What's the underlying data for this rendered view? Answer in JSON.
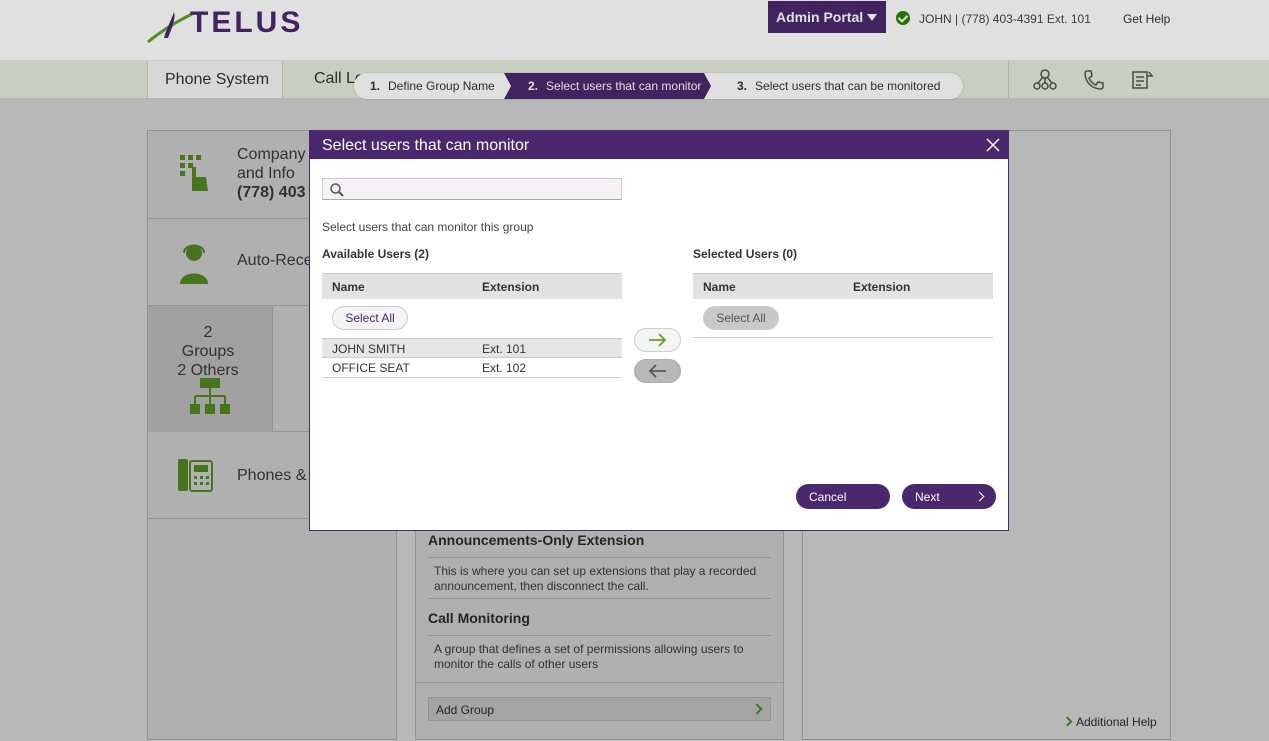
{
  "header": {
    "logo_text": "TELUS",
    "admin_portal_label": "Admin Portal",
    "user_info": "JOHN | (778) 403-4391 Ext. 101",
    "get_help": "Get Help"
  },
  "nav": {
    "tab_phone_system": "Phone System",
    "tab_call_logs": "Call Lo"
  },
  "wizard": {
    "steps": [
      {
        "num": "1.",
        "label": "Define Group Name"
      },
      {
        "num": "2.",
        "label": "Select users that can monitor"
      },
      {
        "num": "3.",
        "label": "Select users that can be monitored"
      }
    ]
  },
  "background": {
    "company_label": "Company\nand Info",
    "company_phone": "(778) 403",
    "auto_receptionist": "Auto-Rece",
    "groups_text": "2 Groups\n2 Others",
    "phones_label": "Phones & ",
    "announcements_title": "Announcements-Only Extension",
    "announcements_desc": "This is where you can set up extensions that play a recorded announcement, then disconnect the call.",
    "monitoring_title": "Call Monitoring",
    "monitoring_desc": "A group that defines a set of permissions allowing users to monitor the calls of other users",
    "add_group": "Add Group",
    "additional_help": "Additional Help"
  },
  "modal": {
    "title": "Select users that can monitor",
    "search_placeholder": "",
    "instruction": "Select users that can monitor this group",
    "available_title": "Available Users (2)",
    "selected_title": "Selected Users (0)",
    "col_name": "Name",
    "col_extension": "Extension",
    "select_all": "Select All",
    "available_users": [
      {
        "name": "JOHN SMITH",
        "ext": "Ext. 101"
      },
      {
        "name": "OFFICE SEAT",
        "ext": "Ext. 102"
      }
    ],
    "cancel": "Cancel",
    "next": "Next"
  },
  "colors": {
    "brand_purple": "#4b286d",
    "brand_green": "#61a22a"
  }
}
